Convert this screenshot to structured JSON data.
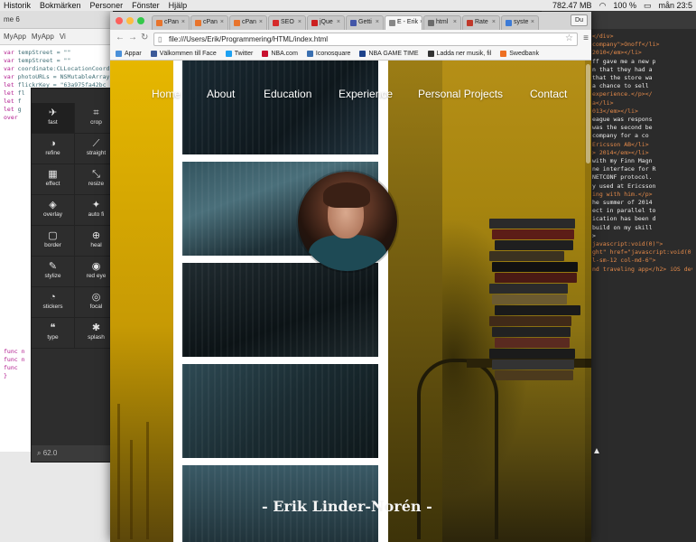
{
  "menubar": {
    "items": [
      "Historik",
      "Bokmärken",
      "Personer",
      "Fönster",
      "Hjälp"
    ],
    "memory": "782.47 MB",
    "battery": "100 %",
    "clock": "mån 23:5"
  },
  "left_editor": {
    "tab": "me 6",
    "crumbs": [
      "MyApp",
      "MyApp",
      "Vi"
    ],
    "lines": [
      {
        "k": "var",
        "rest": " tempStreet = \"\""
      },
      {
        "k": "var",
        "rest": " tempStreet = \"\""
      },
      {
        "k": "var",
        "rest": " coordinate:CLLocationCoordinate"
      },
      {
        "k": "",
        "rest": ""
      },
      {
        "k": "var",
        "rest": " photoURLs = NSMutableArray"
      },
      {
        "k": "",
        "rest": ""
      },
      {
        "k": "let",
        "rest": " flickrKey = \"63a975fa42bc"
      },
      {
        "k": "let",
        "rest": " fl"
      },
      {
        "k": "let",
        "rest": " f"
      },
      {
        "k": "let",
        "rest": " g"
      },
      {
        "k": "",
        "rest": ""
      },
      {
        "k": "over",
        "rest": ""
      }
    ],
    "lower_lines": [
      "func n",
      "func n",
      "",
      "func",
      "",
      "}"
    ]
  },
  "right_editor": {
    "tab": "main.js",
    "lines": [
      "</div>",
      "company\">Onoff</li>",
      "2010</em></li>",
      "ff gave me a new p",
      "n that they had a",
      " that the store wa",
      " a chance to sell",
      " experience.</p></",
      "",
      "",
      "a</li>",
      "013</em></li>",
      "",
      "eague was respons",
      " was the second be",
      " company for a co",
      "",
      "",
      "",
      "Ericsson AB</li>",
      "> 2014</em></li>",
      "",
      " with my Finn Magn",
      "ne interface for R",
      " NETCONF protocol.",
      "y used at Ericsson",
      "ing with him.</p>",
      "he summer of 2014",
      "ect in parallel to",
      "ication has been d",
      " build on my skill",
      "",
      "",
      "",
      "",
      "",
      "",
      "",
      ">",
      "",
      "javascript:void(0)\">",
      "",
      "",
      "ght\" href=\"javascript:void(0)\"",
      "",
      "",
      "l-sm-12 col-md-6\">",
      "nd traveling app</h2> iOS deve"
    ]
  },
  "photo_editor": {
    "tools": [
      {
        "label": "fast",
        "icon": "rocket-icon",
        "glyph": "✈"
      },
      {
        "label": "crop",
        "icon": "crop-icon",
        "glyph": "⌗"
      },
      {
        "label": "refine",
        "icon": "refine-icon",
        "glyph": "◑"
      },
      {
        "label": "straight",
        "icon": "straighten-icon",
        "glyph": "⟋"
      },
      {
        "label": "effect",
        "icon": "film-icon",
        "glyph": "▦"
      },
      {
        "label": "resize",
        "icon": "resize-icon",
        "glyph": "⤡"
      },
      {
        "label": "overlay",
        "icon": "layers-icon",
        "glyph": "◈"
      },
      {
        "label": "auto fi",
        "icon": "auto-fix-icon",
        "glyph": "✦"
      },
      {
        "label": "border",
        "icon": "border-icon",
        "glyph": "▢"
      },
      {
        "label": "heal",
        "icon": "heal-icon",
        "glyph": "⊕"
      },
      {
        "label": "stylize",
        "icon": "brush-icon",
        "glyph": "✎"
      },
      {
        "label": "red eye",
        "icon": "eye-icon",
        "glyph": "◉"
      },
      {
        "label": "stickers",
        "icon": "sticker-icon",
        "glyph": "◔"
      },
      {
        "label": "focal",
        "icon": "focal-icon",
        "glyph": "◎"
      },
      {
        "label": "type",
        "icon": "quote-icon",
        "glyph": "❝"
      },
      {
        "label": "splash",
        "icon": "splash-icon",
        "glyph": "✱"
      }
    ],
    "zoom": "62.0"
  },
  "browser": {
    "tabs": [
      {
        "label": "cPan",
        "color": "#e8742c"
      },
      {
        "label": "cPan",
        "color": "#e8742c"
      },
      {
        "label": "cPan",
        "color": "#e8742c"
      },
      {
        "label": "SEO",
        "color": "#d62b2b"
      },
      {
        "label": "jQue",
        "color": "#cc1f1f"
      },
      {
        "label": "Getti",
        "color": "#4356a8"
      },
      {
        "label": "E - Erik",
        "color": "#888888",
        "active": true
      },
      {
        "label": "html",
        "color": "#6b6b6b"
      },
      {
        "label": "Rate",
        "color": "#c0392b"
      },
      {
        "label": "syste",
        "color": "#3d7bd6"
      }
    ],
    "user": "Du",
    "url": "file:///Users/Erik/Programmering/HTML/index.html",
    "bookmarks": [
      {
        "label": "Appar",
        "color": "#4a90d9"
      },
      {
        "label": "Välkommen till Face",
        "color": "#3b5998"
      },
      {
        "label": "Twitter",
        "color": "#1da1f2"
      },
      {
        "label": "NBA.com",
        "color": "#c8102e"
      },
      {
        "label": "Iconosquare",
        "color": "#3a6fb0"
      },
      {
        "label": "NBA GAME TIME",
        "color": "#1d428a"
      },
      {
        "label": "Ladda ner musik, fil",
        "color": "#333333"
      },
      {
        "label": "Swedbank",
        "color": "#ee7023"
      }
    ]
  },
  "site": {
    "nav": [
      "Home",
      "About",
      "Education",
      "Experience",
      "Personal Projects",
      "Contact"
    ],
    "name": "- Erik Linder-Norén -"
  }
}
